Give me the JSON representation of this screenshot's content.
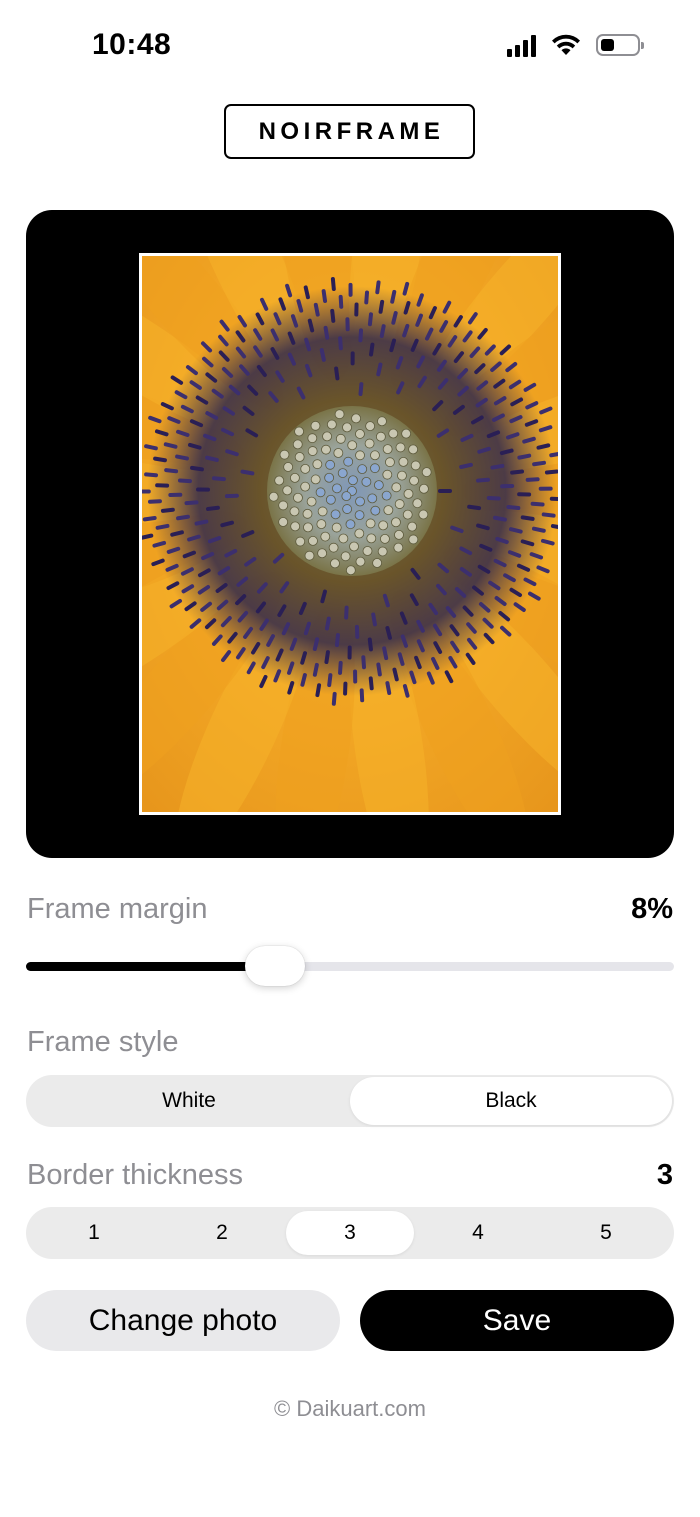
{
  "status_bar": {
    "time": "10:48",
    "icons": [
      "cellular-signal-icon",
      "wifi-icon",
      "battery-icon"
    ],
    "battery_level": 0.25
  },
  "logo": {
    "text": "NOIRFRAME"
  },
  "preview": {
    "frame_color": "#000000",
    "photo_border_color": "#ffffff",
    "photo_subject": "sunflower"
  },
  "frame_margin": {
    "label": "Frame margin",
    "value": "8%",
    "slider_fraction": 0.385
  },
  "frame_style": {
    "label": "Frame style",
    "options": [
      "White",
      "Black"
    ],
    "selected": "Black"
  },
  "border_thickness": {
    "label": "Border thickness",
    "value": "3",
    "options": [
      "1",
      "2",
      "3",
      "4",
      "5"
    ],
    "selected": "3"
  },
  "buttons": {
    "change_photo": "Change photo",
    "save": "Save"
  },
  "footer": {
    "text": "© Daikuart.com"
  },
  "colors": {
    "accent": "#000000",
    "secondary_text": "#8e8e93",
    "control_bg": "#ebebeb"
  }
}
